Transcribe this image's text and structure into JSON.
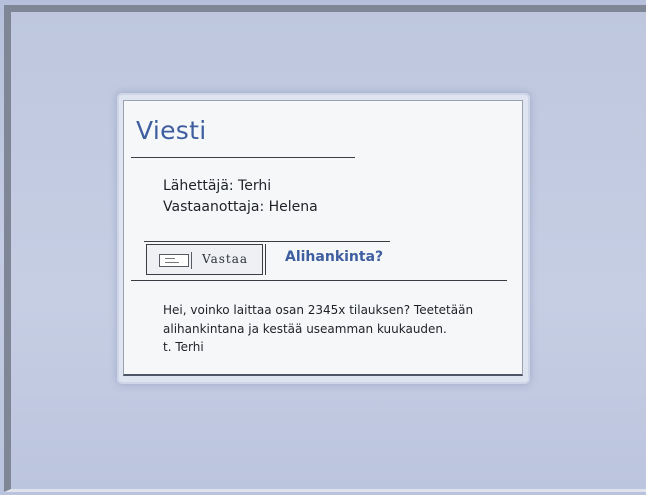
{
  "message": {
    "title": "Viesti",
    "sender_label": "Lähettäjä: Terhi",
    "recipient_label": "Vastaanottaja: Helena",
    "reply_button_label": "Vastaa",
    "reply_icon": "envelope-icon",
    "subject": "Alihankinta?",
    "body_lines": [
      "Hei, voinko laittaa osan 2345x tilauksen? Teetetään",
      "alihankintana ja kestää useamman kuukauden.",
      "t. Terhi"
    ]
  },
  "colors": {
    "background": "#b9c3dc",
    "accent_blue": "#3e5ea0",
    "window": "#f6f7f9"
  }
}
